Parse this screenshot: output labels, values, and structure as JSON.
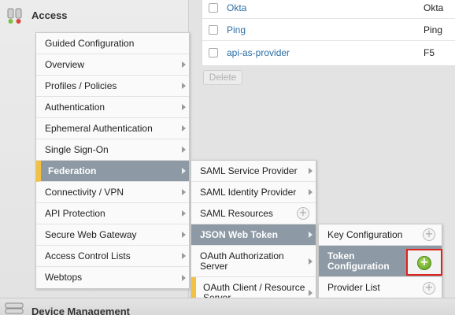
{
  "sections": {
    "access": "Access",
    "device_management": "Device Management"
  },
  "providers": [
    {
      "name": "Okta",
      "type": "Okta"
    },
    {
      "name": "Ping",
      "type": "Ping"
    },
    {
      "name": "api-as-provider",
      "type": "F5"
    }
  ],
  "delete_label": "Delete",
  "menu_main": [
    "Guided Configuration",
    "Overview",
    "Profiles / Policies",
    "Authentication",
    "Ephemeral Authentication",
    "Single Sign-On",
    "Federation",
    "Connectivity / VPN",
    "API Protection",
    "Secure Web Gateway",
    "Access Control Lists",
    "Webtops"
  ],
  "menu_federation": [
    "SAML Service Provider",
    "SAML Identity Provider",
    "SAML Resources",
    "JSON Web Token",
    "OAuth Authorization Server",
    "OAuth Client / Resource Server"
  ],
  "menu_jwt": [
    "Key Configuration",
    "Token Configuration",
    "Provider List"
  ],
  "colors": {
    "selected_bg": "#8d9aa5",
    "accent": "#f3c242",
    "highlight_border": "#e0201b",
    "link": "#2a6ea6"
  }
}
